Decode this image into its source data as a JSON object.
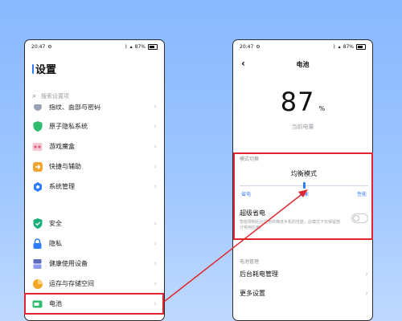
{
  "left_phone": {
    "status": {
      "time": "20:47",
      "right": "87%"
    },
    "title": "设置",
    "search_placeholder": "搜索设置项",
    "partial_item_label": "指纹、面部与密码",
    "items": [
      {
        "label": "原子隐私系统",
        "icon": "shield-icon",
        "color": "#2EBD6F"
      },
      {
        "label": "游戏魔盒",
        "icon": "game-box-icon",
        "color": "#E88AA0"
      },
      {
        "label": "快捷与辅助",
        "icon": "arrow-icon",
        "color": "#F3A531"
      },
      {
        "label": "系统管理",
        "icon": "gear-icon",
        "color": "#2D7CFF"
      },
      {
        "label": "安全",
        "icon": "shield-check-icon",
        "color": "#1BB07A"
      },
      {
        "label": "隐私",
        "icon": "lock-icon",
        "color": "#2D7CFF"
      },
      {
        "label": "健康使用设备",
        "icon": "hourglass-icon",
        "color": "#5C6BC0"
      },
      {
        "label": "运存与存储空间",
        "icon": "pie-icon",
        "color": "#F5A623"
      },
      {
        "label": "电池",
        "icon": "battery-icon",
        "color": "#2EBD6F"
      }
    ]
  },
  "right_phone": {
    "status": {
      "time": "20:47",
      "right": "87%"
    },
    "title": "电池",
    "percent": "87",
    "percent_unit": "%",
    "caption": "当前电量",
    "mode_section_label": "模式切换",
    "mode_value": "均衡模式",
    "slider_labels": [
      "省电",
      "均衡",
      "性能"
    ],
    "super_saver_title": "超级省电",
    "super_saver_desc": "智能限制后台应用并降低手机的性能，此模式下仅保留部分常用应用。",
    "battery_mgmt_label": "电池管理",
    "items": [
      {
        "label": "后台耗电管理"
      },
      {
        "label": "更多设置"
      }
    ]
  },
  "colors": {
    "accent": "#2D7CFF",
    "highlight": "#E0272F"
  }
}
